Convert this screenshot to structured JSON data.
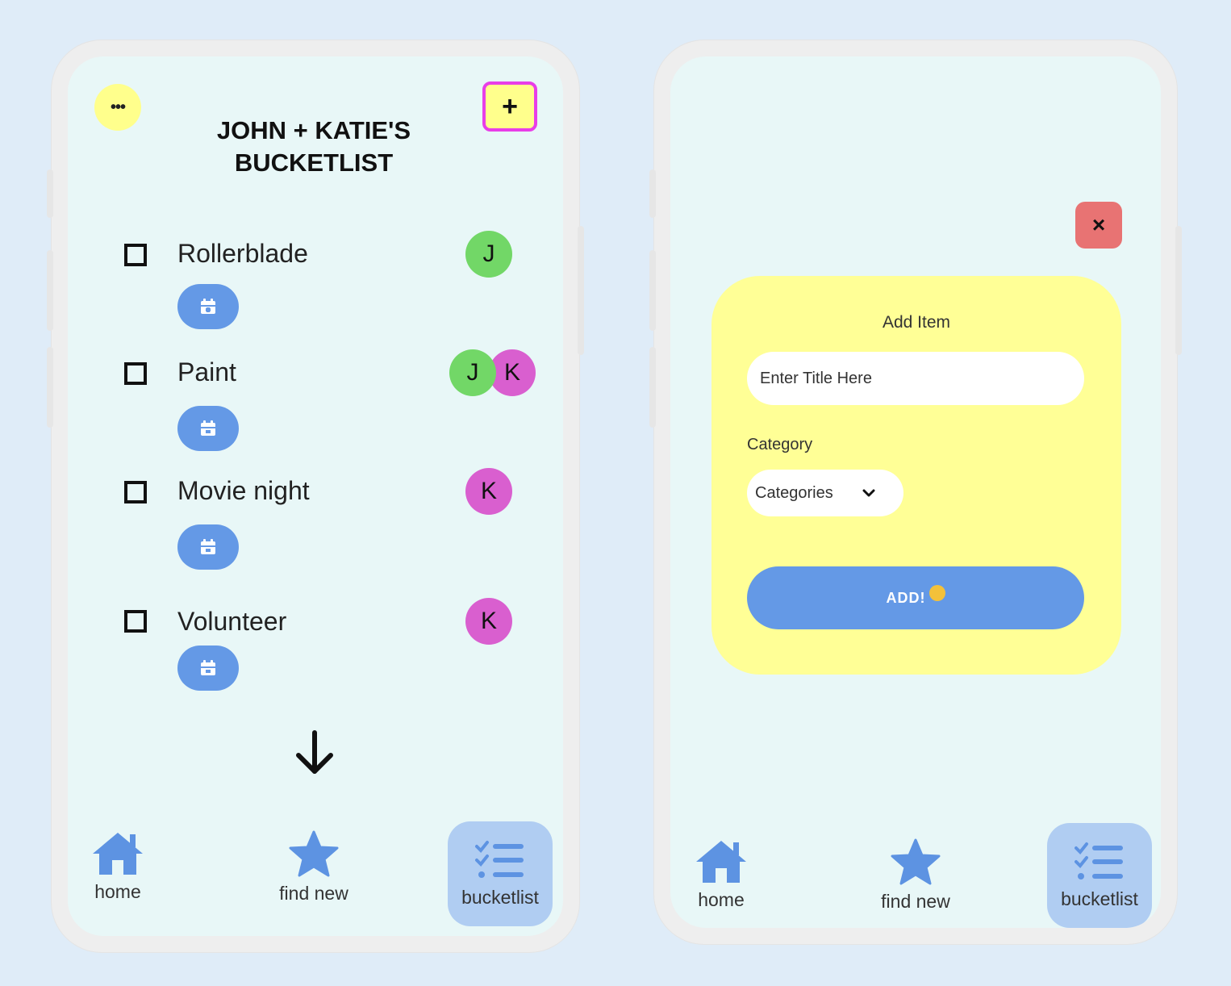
{
  "left_screen": {
    "menu_label": "•••",
    "add_label": "+",
    "title_line1": "JOHN + KATIE'S",
    "title_line2": "BUCKETLIST",
    "items": [
      {
        "label": "Rollerblade",
        "avatars": [
          "J"
        ]
      },
      {
        "label": "Paint",
        "avatars": [
          "J",
          "K"
        ]
      },
      {
        "label": "Movie night",
        "avatars": [
          "K"
        ]
      },
      {
        "label": "Volunteer",
        "avatars": [
          "K"
        ]
      }
    ],
    "icons": {
      "menu": "ellipsis-icon",
      "add": "plus-icon",
      "calendar": "calendar-icon",
      "scroll": "arrow-down-icon"
    }
  },
  "right_screen": {
    "close_label": "×",
    "card_title": "Add Item",
    "title_placeholder": "Enter Title Here",
    "category_label": "Category",
    "category_selected": "Categories",
    "submit_label": "ADD!"
  },
  "nav": {
    "items": [
      {
        "label": "home",
        "icon": "home-icon"
      },
      {
        "label": "find new",
        "icon": "star-icon"
      },
      {
        "label": "bucketlist",
        "icon": "checklist-icon"
      }
    ],
    "active": "bucketlist"
  },
  "colors": {
    "background": "#dfecf8",
    "screen": "#e8f7f7",
    "yellow": "#ffff8c",
    "highlight_border": "#e83ee8",
    "blue": "#6499e6",
    "nav_active": "#b0cdf2",
    "avatar_j": "#72d767",
    "avatar_k": "#d95fcf",
    "close_red": "#e87373"
  }
}
